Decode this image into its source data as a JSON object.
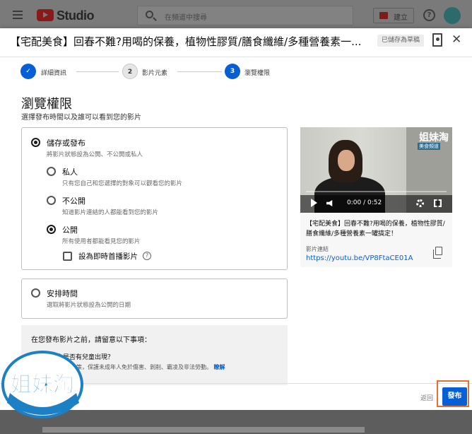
{
  "studio": {
    "logo_text": "Studio",
    "search_placeholder": "在頻道中搜尋",
    "create_label": "建立",
    "help_glyph": "?"
  },
  "dialog": {
    "title": "【宅配美食】回春不難?用喝的保養，植物性膠質/膳食纖維/多種營養素一...",
    "saved_badge": "已儲存為草稿",
    "close_glyph": "✕"
  },
  "steps": [
    {
      "number": "✓",
      "label": "詳細資訊"
    },
    {
      "number": "2",
      "label": "影片元素"
    },
    {
      "number": "3",
      "label": "瀏覽權限"
    }
  ],
  "visibility": {
    "title": "瀏覽權限",
    "subtitle": "選擇發布時間以及誰可以看到您的影片",
    "save_or_publish": {
      "label": "儲存或發布",
      "desc": "將影片狀態設為公開、不公開或私人"
    },
    "private": {
      "label": "私人",
      "desc": "只有您自己和您選擇的對象可以觀看您的影片"
    },
    "unlisted": {
      "label": "不公開",
      "desc": "知道影片連結的人都能看到您的影片"
    },
    "public": {
      "label": "公開",
      "desc": "所有使用者都能看見您的影片",
      "selected": true
    },
    "premiere": {
      "label": "設為即時首播影片",
      "checked": false,
      "help_glyph": "?"
    },
    "schedule": {
      "label": "安排時間",
      "desc": "選取將影片狀態設為公開的日期"
    }
  },
  "preview": {
    "brand_mark": "姐妹淘",
    "brand_sub": "美食頻道",
    "time": "0:00 / 0:52",
    "video_title": "【宅配美食】回春不難?用喝的保養，植物性膠質/膳食纖維/多種營養素一罐搞定！",
    "link_label": "影片連結",
    "link_url": "https://youtu.be/VP8FtaCE01A"
  },
  "notice": {
    "title": "在您發布影片之前，請留意以下事項：",
    "question": "您的影片中是否有兒童出現？",
    "body": "請務必遵守相關政策，保護未成年人免於傷害、剝削、霸凌及非法勞動。",
    "link": "瞭解"
  },
  "footer": {
    "back_label": "返回",
    "publish_label": "發布"
  },
  "watermark": {
    "text": "姐妹淘"
  }
}
